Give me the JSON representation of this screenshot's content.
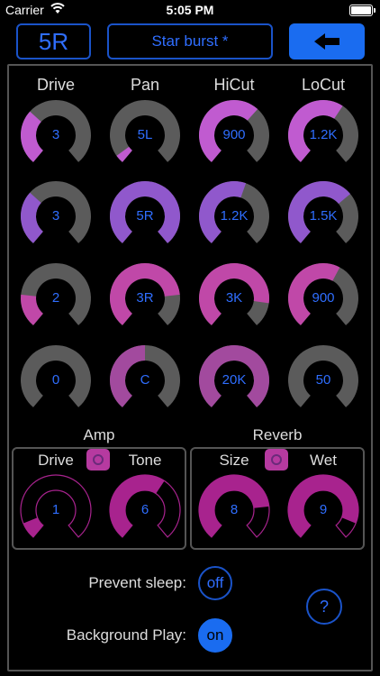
{
  "status": {
    "carrier": "Carrier",
    "time": "5:05 PM"
  },
  "header": {
    "channel_label": "5R",
    "preset_name": "Star burst *",
    "back_icon": "left-arrow-icon"
  },
  "columns": [
    "Drive",
    "Pan",
    "HiCut",
    "LoCut"
  ],
  "rows": [
    {
      "color": "#c05bd0",
      "knobs": [
        {
          "value": "3",
          "level": 0.33
        },
        {
          "value": "5L",
          "level": 0.05
        },
        {
          "value": "900",
          "level": 0.65
        },
        {
          "value": "1.2K",
          "level": 0.62
        }
      ]
    },
    {
      "color": "#9058cc",
      "knobs": [
        {
          "value": "3",
          "level": 0.33
        },
        {
          "value": "5R",
          "level": 1.0
        },
        {
          "value": "1.2K",
          "level": 0.57
        },
        {
          "value": "1.5K",
          "level": 0.68
        }
      ]
    },
    {
      "color": "#c048a8",
      "knobs": [
        {
          "value": "2",
          "level": 0.2
        },
        {
          "value": "3R",
          "level": 0.8
        },
        {
          "value": "3K",
          "level": 0.85
        },
        {
          "value": "900",
          "level": 0.6
        }
      ]
    },
    {
      "color": "#a24a9e",
      "knobs": [
        {
          "value": "0",
          "level": 0.0
        },
        {
          "value": "C",
          "level": 0.5
        },
        {
          "value": "20K",
          "level": 1.0
        },
        {
          "value": "50",
          "level": 0.0
        }
      ]
    }
  ],
  "amp": {
    "title": "Amp",
    "enabled": false,
    "knobs": [
      {
        "label": "Drive",
        "value": "1",
        "level": 0.1
      },
      {
        "label": "Tone",
        "value": "6",
        "level": 0.62
      }
    ]
  },
  "reverb": {
    "title": "Reverb",
    "enabled": true,
    "knobs": [
      {
        "label": "Size",
        "value": "8",
        "level": 0.8
      },
      {
        "label": "Wet",
        "value": "9",
        "level": 0.9
      }
    ]
  },
  "prefs": {
    "prevent_sleep": {
      "label": "Prevent sleep:",
      "state": "off"
    },
    "background_play": {
      "label": "Background Play:",
      "state": "on"
    },
    "help_label": "?"
  },
  "colors": {
    "accent": "#1a6cf0",
    "track": "#5b5b5b",
    "fx": "#a8238e"
  }
}
